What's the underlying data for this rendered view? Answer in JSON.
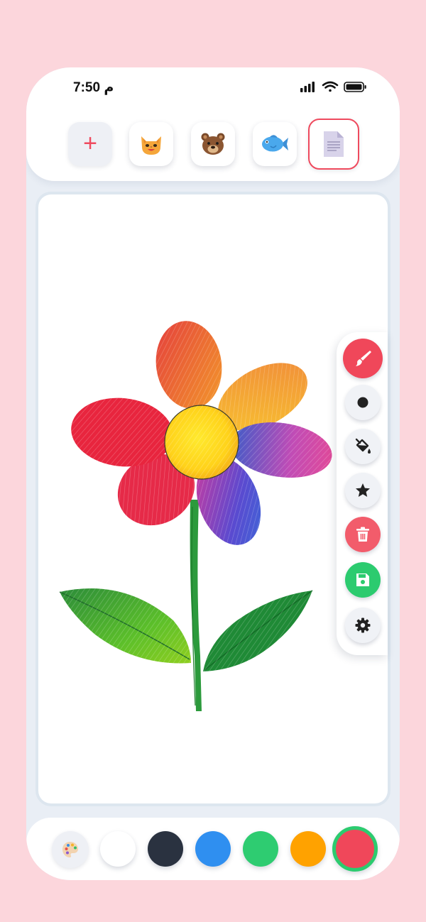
{
  "status": {
    "time": "7:50 م"
  },
  "templates": {
    "add_label": "+",
    "items": [
      {
        "name": "cat",
        "icon": "cat-face-icon"
      },
      {
        "name": "bear",
        "icon": "bear-face-icon"
      },
      {
        "name": "fish",
        "icon": "fish-icon"
      },
      {
        "name": "blank-page",
        "icon": "page-icon",
        "selected": true
      }
    ]
  },
  "tools": [
    {
      "name": "brush",
      "icon": "paintbrush-icon",
      "active": true,
      "color": "#f0475a"
    },
    {
      "name": "brush-size",
      "icon": "dot-icon"
    },
    {
      "name": "fill",
      "icon": "paint-bucket-icon"
    },
    {
      "name": "stamp",
      "icon": "star-icon"
    },
    {
      "name": "clear",
      "icon": "trash-icon",
      "color": "#f25c6b"
    },
    {
      "name": "save",
      "icon": "floppy-disk-icon",
      "color": "#2ccb6f"
    },
    {
      "name": "settings",
      "icon": "gear-icon"
    }
  ],
  "palette": {
    "icon": "palette-icon",
    "colors": [
      "#ffffff",
      "#2a3240",
      "#2f8ff0",
      "#2ecc71",
      "#ffa200",
      "#f0475a"
    ],
    "selected": "#f0475a"
  },
  "canvas": {
    "drawing": "crayon-flower"
  }
}
